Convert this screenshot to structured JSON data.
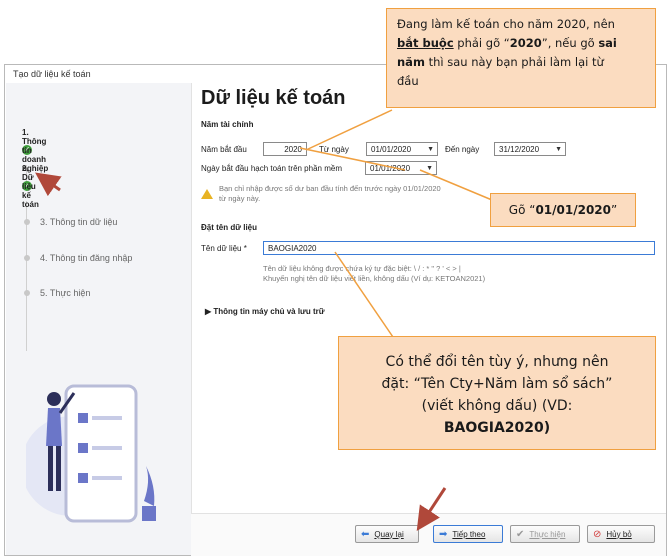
{
  "window": {
    "title": "Tạo dữ liệu kế toán"
  },
  "steps": [
    {
      "label": "1. Thông tin doanh nghiệp",
      "state": "done"
    },
    {
      "label": "2. Dữ liệu kế toán",
      "state": "active"
    },
    {
      "label": "3. Thông tin dữ liệu",
      "state": "todo"
    },
    {
      "label": "4. Thông tin đăng nhập",
      "state": "todo"
    },
    {
      "label": "5. Thực hiện",
      "state": "todo"
    }
  ],
  "main": {
    "title": "Dữ liệu kế toán",
    "fiscal": {
      "section": "Năm tài chính",
      "start_year_label": "Năm bắt đầu",
      "start_year_value": "2020",
      "from_label": "Từ ngày",
      "from_value": "01/01/2020",
      "to_label": "Đến ngày",
      "to_value": "31/12/2020",
      "software_start_label": "Ngày bắt đầu hạch toán trên phần mềm",
      "software_start_value": "01/01/2020",
      "warning_line1": "Bạn chỉ nhập được số dư ban đầu tính đến trước ngày 01/01/2020",
      "warning_line2": "từ ngày này."
    },
    "naming": {
      "section": "Đặt tên dữ liệu",
      "name_label": "Tên dữ liệu *",
      "name_value": "BAOGIA2020",
      "hint_line1": "Tên dữ liệu không được chứa ký tự đặc biệt: \\ / : * \" ? ' < > |",
      "hint_line2": "Khuyến nghị tên dữ liệu viết liền, không dấu (Ví dụ: KETOAN2021)"
    },
    "server_section": "Thông tin máy chủ và lưu trữ"
  },
  "buttons": {
    "back": "Quay lại",
    "next": "Tiếp theo",
    "execute": "Thực hiện",
    "cancel": "Hủy bỏ"
  },
  "callouts": {
    "top_line1": "Đang làm kế toán cho năm 2020, nên",
    "top_line2_a": "bắt buộc",
    "top_line2_b": " phải gõ “",
    "top_line2_c": "2020",
    "top_line2_d": "”, nếu gõ ",
    "top_line2_e": "sai",
    "top_line3_a": "năm",
    "top_line3_b": " thì sau này bạn phải làm lại từ",
    "top_line4": "đầu",
    "mid_a": "Gõ “",
    "mid_b": "01/01/2020",
    "mid_c": "”",
    "bottom_line1": "Có thể đổi tên tùy ý, nhưng nên",
    "bottom_line2": "đặt: “Tên Cty+Năm làm sổ sách”",
    "bottom_line3": "(viết không dấu) (VD:",
    "bottom_line4": "BAOGIA2020)"
  },
  "colors": {
    "callout_fill": "#fbdcc0",
    "callout_border": "#f0a040",
    "arrow": "#b0483a",
    "done_green": "#3d9c3a"
  }
}
